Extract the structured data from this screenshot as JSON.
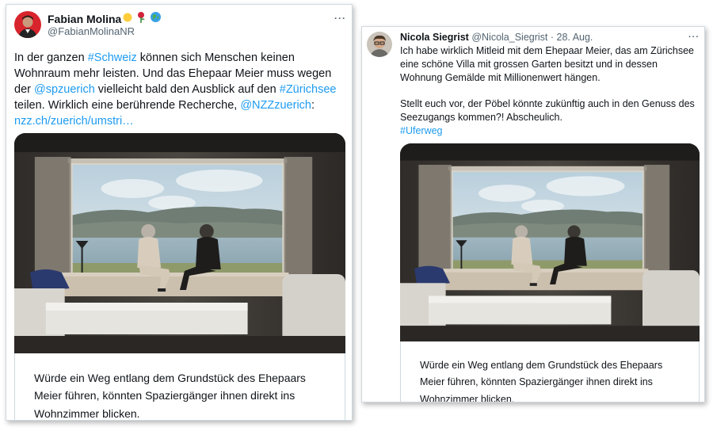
{
  "left_tweet": {
    "name": "Fabian Molina",
    "handle": "@FabianMolinaNR",
    "more": "···",
    "body": {
      "t1": "In der ganzen ",
      "l1": "#Schweiz",
      "t2": " können sich Menschen keinen Wohnraum mehr leisten. Und das Ehepaar Meier muss wegen der ",
      "l2": "@spzuerich",
      "t3": " vielleicht bald den Ausblick auf den ",
      "l3": "#Zürichsee",
      "t4": " teilen. Wirklich eine berührende Recherche, ",
      "l4": "@NZZzuerich",
      "t5": ":",
      "l5": "nzz.ch/zuerich/umstri…"
    },
    "card_caption": "Würde ein Weg entlang dem Grundstück des Ehepaars Meier führen, könnten Spaziergänger ihnen direkt ins Wohnzimmer blicken."
  },
  "right_tweet": {
    "name": "Nicola Siegrist",
    "handle": "@Nicola_Siegrist",
    "separator": "·",
    "date": "28. Aug.",
    "more": "···",
    "para1": "Ich habe wirklich Mitleid mit dem Ehepaar Meier, das am Zürichsee eine schöne Villa mit grossen Garten besitzt und in dessen Wohnung Gemälde mit Millionenwert hängen.",
    "para2": "Stellt euch vor, der Pöbel könnte zukünftig auch in den Genuss des Seezugangs kommen?! Abscheulich.",
    "hashtag": "#Uferweg",
    "card_caption": "Würde ein Weg entlang dem Grundstück des Ehepaars Meier führen, könnten Spaziergänger ihnen direkt ins Wohnzimmer blicken."
  },
  "icons": {
    "badge_1": "sun-emoji",
    "badge_2": "rose-emoji",
    "badge_3": "globe-emoji"
  },
  "colors": {
    "link": "#1d9bf0",
    "text": "#0f1419",
    "secondary": "#536471"
  }
}
